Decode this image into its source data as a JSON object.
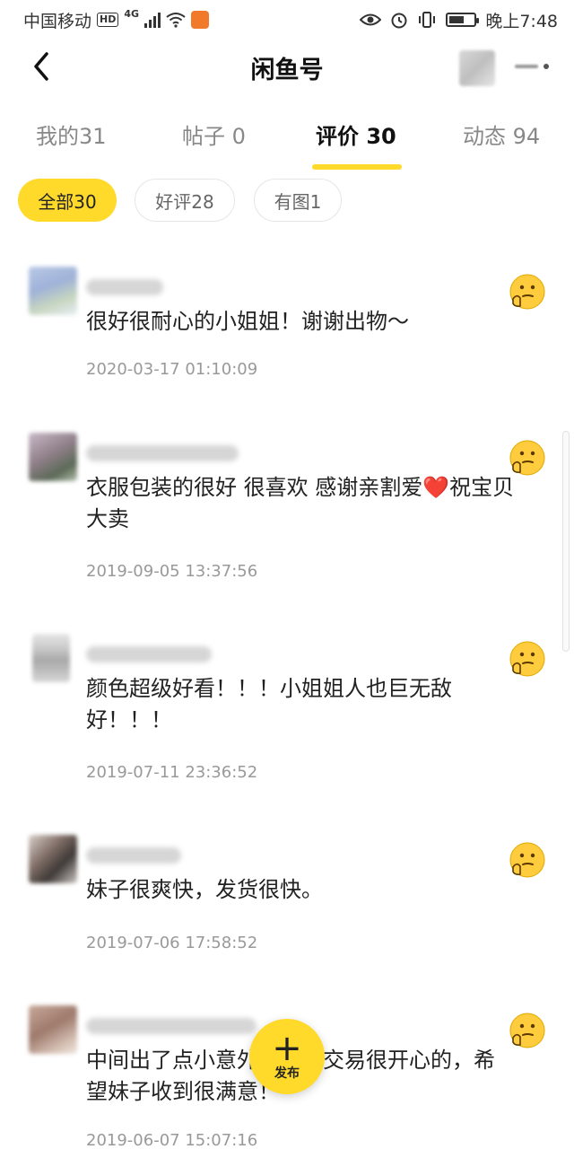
{
  "status_bar": {
    "carrier": "中国移动",
    "hd": "HD",
    "network": "4G",
    "time": "晚上7:48"
  },
  "nav": {
    "title": "闲鱼号"
  },
  "tabs": [
    {
      "label": "我的31",
      "active": false
    },
    {
      "label": "帖子 0",
      "active": false
    },
    {
      "label": "评价 30",
      "active": true
    },
    {
      "label": "动态 94",
      "active": false
    }
  ],
  "filters": [
    {
      "label": "全部30",
      "active": true
    },
    {
      "label": "好评28",
      "active": false
    },
    {
      "label": "有图1",
      "active": false
    }
  ],
  "reviews": [
    {
      "text": "很好很耐心的小姐姐！谢谢出物～",
      "date": "2020-03-17 01:10:09",
      "reaction": "good-review-emoji"
    },
    {
      "text": "衣服包装的很好  很喜欢  感谢亲割爱❤️祝宝贝大卖",
      "date": "2019-09-05 13:37:56",
      "reaction": "good-review-emoji"
    },
    {
      "text": "颜色超级好看！！！小姐姐人也巨无敌好！！！",
      "date": "2019-07-11 23:36:52",
      "reaction": "good-review-emoji"
    },
    {
      "text": "妹子很爽快，发货很快。",
      "date": "2019-07-06 17:58:52",
      "reaction": "good-review-emoji"
    },
    {
      "text": "中间出了点小意外，妹子交易很开心的，希望妹子收到很满意！",
      "date": "2019-06-07 15:07:16",
      "reaction": "good-review-emoji"
    }
  ],
  "fab": {
    "plus": "+",
    "label": "发布"
  },
  "colors": {
    "accent": "#ffda2a",
    "text": "#222222",
    "muted": "#999999"
  }
}
